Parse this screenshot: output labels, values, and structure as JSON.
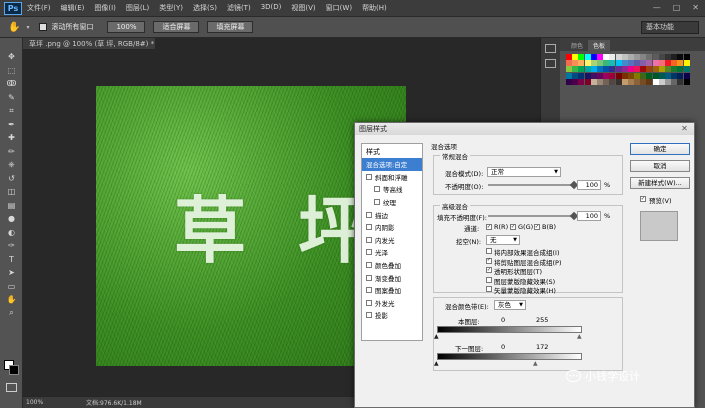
{
  "app": {
    "logo": "Ps",
    "menu": [
      "文件(F)",
      "编辑(E)",
      "图像(I)",
      "图层(L)",
      "类型(Y)",
      "选择(S)",
      "滤镜(T)",
      "3D(D)",
      "视图(V)",
      "窗口(W)",
      "帮助(H)"
    ],
    "window_controls": [
      "—",
      "□",
      "✕"
    ]
  },
  "options_bar": {
    "scroll_all_windows": "滚动所有窗口",
    "zoom_100": "100%",
    "fit_screen": "适合屏幕",
    "fill_screen": "填充屏幕",
    "workspace": "基本功能"
  },
  "document": {
    "tab_title": "草坪 .png @ 100% (草 坪, RGB/8#) *",
    "canvas_text": "草坪",
    "zoom": "100%",
    "file_info": "文档:976.6K/1.18M"
  },
  "panels": {
    "tabs": [
      "颜色",
      "色板"
    ],
    "active_tab": "色板",
    "swatch_colors": [
      "#ff0000",
      "#ffff00",
      "#00ff00",
      "#00ffff",
      "#0000ff",
      "#ff00ff",
      "#ffffff",
      "#ebebeb",
      "#d6d6d6",
      "#c2c2c2",
      "#adadad",
      "#999999",
      "#858585",
      "#707070",
      "#5c5c5c",
      "#474747",
      "#333333",
      "#1f1f1f",
      "#0a0a0a",
      "#000000",
      "#f26c4f",
      "#f68e55",
      "#fbaf5c",
      "#fff467",
      "#acd372",
      "#7cc576",
      "#3bb878",
      "#1abbb4",
      "#00bff3",
      "#438ccb",
      "#5574b9",
      "#605ca8",
      "#855fa8",
      "#a763a8",
      "#f06ea9",
      "#f26d7d",
      "#ed1c24",
      "#f26522",
      "#f7941d",
      "#fff200",
      "#8dc63f",
      "#39b54a",
      "#00a651",
      "#00a99d",
      "#00aeef",
      "#0072bc",
      "#0054a6",
      "#2e3192",
      "#662d91",
      "#92278f",
      "#ec008c",
      "#ed145b",
      "#9e0b0f",
      "#a0410d",
      "#a36209",
      "#aba000",
      "#598527",
      "#1a7b30",
      "#007236",
      "#00746b",
      "#0076a3",
      "#004b80",
      "#003471",
      "#1b1464",
      "#440e62",
      "#630460",
      "#9e005d",
      "#9e0039",
      "#790000",
      "#7b2e00",
      "#7d4900",
      "#827b00",
      "#406618",
      "#005e20",
      "#005826",
      "#005952",
      "#005b7f",
      "#003663",
      "#002157",
      "#0d004c",
      "#32004b",
      "#4b0049",
      "#7b0046",
      "#7a0026",
      "#c7b299",
      "#998675",
      "#736357",
      "#534741",
      "#37302d",
      "#c69c6d",
      "#a67c52",
      "#8c6239",
      "#754c24",
      "#603913",
      "#ffffff",
      "#cccccc",
      "#999999",
      "#666666",
      "#333333",
      "#000000"
    ]
  },
  "tools": [
    "move-icon",
    "marquee-icon",
    "lasso-icon",
    "quick-select-icon",
    "crop-icon",
    "eyedropper-icon",
    "healing-icon",
    "brush-icon",
    "stamp-icon",
    "history-brush-icon",
    "eraser-icon",
    "gradient-icon",
    "blur-icon",
    "dodge-icon",
    "pen-icon",
    "type-icon",
    "path-select-icon",
    "shape-icon",
    "hand-icon",
    "zoom-icon"
  ],
  "dialog": {
    "title": "图层样式",
    "close": "✕",
    "styles_header": "样式",
    "style_items": [
      {
        "label": "混合选项:自定",
        "checked": false,
        "selected": true,
        "checkbox": false,
        "indent": false
      },
      {
        "label": "斜面和浮雕",
        "checked": false,
        "selected": false,
        "checkbox": true,
        "indent": false
      },
      {
        "label": "等高线",
        "checked": false,
        "selected": false,
        "checkbox": true,
        "indent": true
      },
      {
        "label": "纹理",
        "checked": false,
        "selected": false,
        "checkbox": true,
        "indent": true
      },
      {
        "label": "描边",
        "checked": false,
        "selected": false,
        "checkbox": true,
        "indent": false
      },
      {
        "label": "内阴影",
        "checked": false,
        "selected": false,
        "checkbox": true,
        "indent": false
      },
      {
        "label": "内发光",
        "checked": false,
        "selected": false,
        "checkbox": true,
        "indent": false
      },
      {
        "label": "光泽",
        "checked": false,
        "selected": false,
        "checkbox": true,
        "indent": false
      },
      {
        "label": "颜色叠加",
        "checked": false,
        "selected": false,
        "checkbox": true,
        "indent": false
      },
      {
        "label": "渐变叠加",
        "checked": false,
        "selected": false,
        "checkbox": true,
        "indent": false
      },
      {
        "label": "图案叠加",
        "checked": false,
        "selected": false,
        "checkbox": true,
        "indent": false
      },
      {
        "label": "外发光",
        "checked": false,
        "selected": false,
        "checkbox": true,
        "indent": false
      },
      {
        "label": "投影",
        "checked": false,
        "selected": false,
        "checkbox": true,
        "indent": false
      }
    ],
    "blending_options_title": "混合选项",
    "general_blending": "常规混合",
    "blend_mode_label": "混合模式(D):",
    "blend_mode_value": "正常",
    "opacity_label": "不透明度(O):",
    "opacity_value": "100",
    "percent": "%",
    "advanced_blending": "高级混合",
    "fill_opacity_label": "填充不透明度(F):",
    "fill_opacity_value": "100",
    "channels_label": "通道:",
    "channel_r": "R(R)",
    "channel_g": "G(G)",
    "channel_b": "B(B)",
    "knockout_label": "挖空(N):",
    "knockout_value": "无",
    "adv_options": [
      {
        "label": "将内部效果混合成组(I)",
        "checked": false
      },
      {
        "label": "将剪贴图层混合成组(P)",
        "checked": true
      },
      {
        "label": "透明形状图层(T)",
        "checked": true
      },
      {
        "label": "图层蒙版隐藏效果(S)",
        "checked": false
      },
      {
        "label": "矢量蒙版隐藏效果(H)",
        "checked": false
      }
    ],
    "blend_if_label": "混合颜色带(E):",
    "blend_if_value": "灰色",
    "this_layer_label": "本图层:",
    "this_layer_min": "0",
    "this_layer_max": "255",
    "underlying_label": "下一图层:",
    "underlying_min": "0",
    "underlying_max": "172",
    "ok": "确定",
    "cancel": "取消",
    "new_style": "新建样式(W)...",
    "preview": "预览(V)"
  },
  "watermark": {
    "icon": "•••",
    "text": "小钱学设计"
  }
}
